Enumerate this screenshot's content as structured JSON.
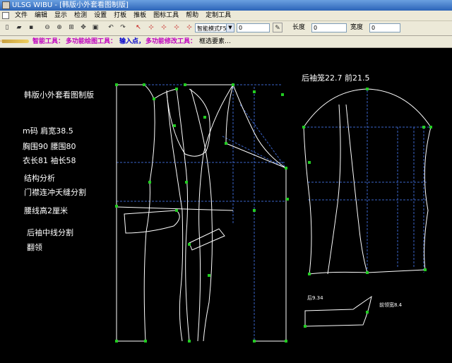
{
  "window": {
    "title": "ULSG WIBU - [韩版小外套看图制版]"
  },
  "menu": [
    "文件",
    "编辑",
    "显示",
    "检测",
    "设置",
    "打板",
    "推板",
    "图标工具",
    "帮助",
    "定制工具"
  ],
  "toolbar": {
    "mode_select": "智能模式F5",
    "mode_value": "0",
    "length_label": "长度",
    "length_value": "0",
    "width_label": "宽度",
    "width_value": "0"
  },
  "status": {
    "smart_tool": "智能工具：",
    "draw_tool": "多功能绘图工具：",
    "input_point": "输入点，",
    "modify_tool": "多功能修改工具：",
    "select_elements": "框选要素…"
  },
  "canvas": {
    "title": "韩版小外套看图制版",
    "size_line1": "m码   肩宽38.5",
    "size_line2": "胸围90  腰围80",
    "size_line3": "衣长81   袖长58",
    "analysis_title": "结构分析",
    "analysis_1": "门襟连冲夭缝分割",
    "analysis_2": "腰线高2厘米",
    "analysis_3": "后袖中线分割",
    "analysis_4": "翻领",
    "sleeve_note": "后袖笼22.7   前21.5",
    "collar_back": "后9.34",
    "collar_front": "前领宽8.4"
  },
  "colors": {
    "pattern_line": "#ffffff",
    "guide_line": "#3a63c8",
    "point_marker": "#22cc22",
    "status_accent": "#c000c0",
    "status_blue": "#0000cc"
  }
}
